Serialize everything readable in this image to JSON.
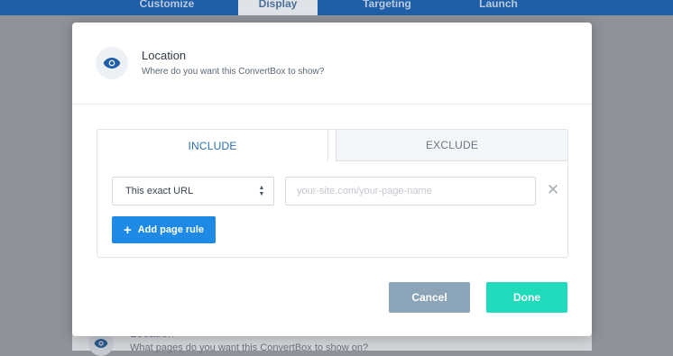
{
  "nav": {
    "tabs": [
      {
        "label": "Customize"
      },
      {
        "label": "Display"
      },
      {
        "label": "Targeting"
      },
      {
        "label": "Launch"
      }
    ],
    "active_index": 1
  },
  "background_row": {
    "title": "Location",
    "subtitle": "What pages do you want this ConvertBox to show on?"
  },
  "modal": {
    "title": "Location",
    "subtitle": "Where do you want this ConvertBox to show?",
    "tabs": {
      "include": "INCLUDE",
      "exclude": "EXCLUDE",
      "active": "include"
    },
    "rule": {
      "match_type": "This exact URL",
      "url_value": "",
      "url_placeholder": "your-site.com/your-page-name"
    },
    "add_rule_label": "Add page rule",
    "cancel_label": "Cancel",
    "done_label": "Done"
  },
  "colors": {
    "accent_blue": "#1e8ae6",
    "done_green": "#1fdbbb",
    "cancel_gray": "#8ba4b8",
    "nav_blue": "#1f5fa8",
    "eye_blue": "#2a5a90"
  },
  "icons": {
    "location": "eye-icon",
    "remove": "close-icon",
    "add": "plus-icon",
    "select": "sort-arrows-icon"
  }
}
